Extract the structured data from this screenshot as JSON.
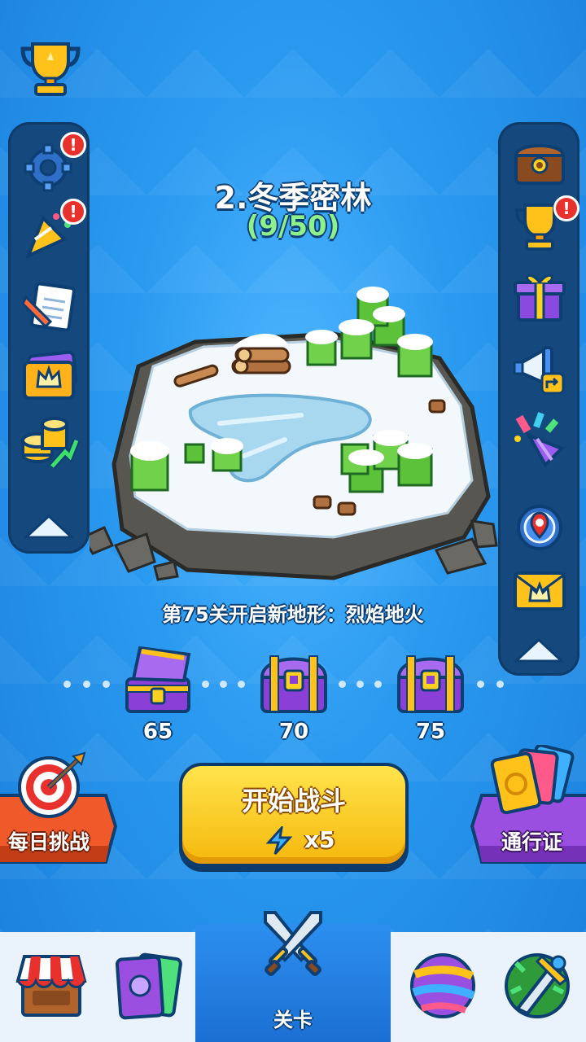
{
  "level": {
    "title": "2.冬季密林",
    "progress": "(9/50)"
  },
  "terrain_notice": "第75关开启新地形：烈焰地火",
  "chests": [
    {
      "label": "65",
      "state": "opened"
    },
    {
      "label": "70",
      "state": "closed"
    },
    {
      "label": "75",
      "state": "closed"
    }
  ],
  "start_battle": {
    "label": "开始战斗",
    "energy_cost": "x5"
  },
  "daily_challenge": {
    "label": "每日挑战"
  },
  "battle_pass": {
    "label": "通行证"
  },
  "left_menu": [
    {
      "icon": "settings-gear-icon",
      "badge": "!"
    },
    {
      "icon": "party-popper-icon",
      "badge": "!"
    },
    {
      "icon": "notes-pencil-icon"
    },
    {
      "icon": "crown-card-icon"
    },
    {
      "icon": "coins-growth-icon"
    }
  ],
  "right_menu": [
    {
      "icon": "treasure-chest-icon"
    },
    {
      "icon": "trophy-icon",
      "badge": "!"
    },
    {
      "icon": "gift-box-icon"
    },
    {
      "icon": "megaphone-share-icon"
    },
    {
      "icon": "confetti-cone-icon"
    },
    {
      "icon": "lucky-wheel-icon"
    },
    {
      "icon": "crown-mail-icon"
    }
  ],
  "bottom_nav": {
    "tabs": [
      {
        "icon": "shop-icon"
      },
      {
        "icon": "cards-icon"
      },
      {
        "icon": "crossed-swords-icon",
        "label": "关卡",
        "active": true
      },
      {
        "icon": "ball-icon"
      },
      {
        "icon": "guild-sword-icon"
      }
    ]
  },
  "colors": {
    "background": "#1f8ee6",
    "panel": "#15497e",
    "progress_green": "#8ef08a",
    "start_button": "#ffd21f",
    "badge_red": "#e8302d"
  }
}
